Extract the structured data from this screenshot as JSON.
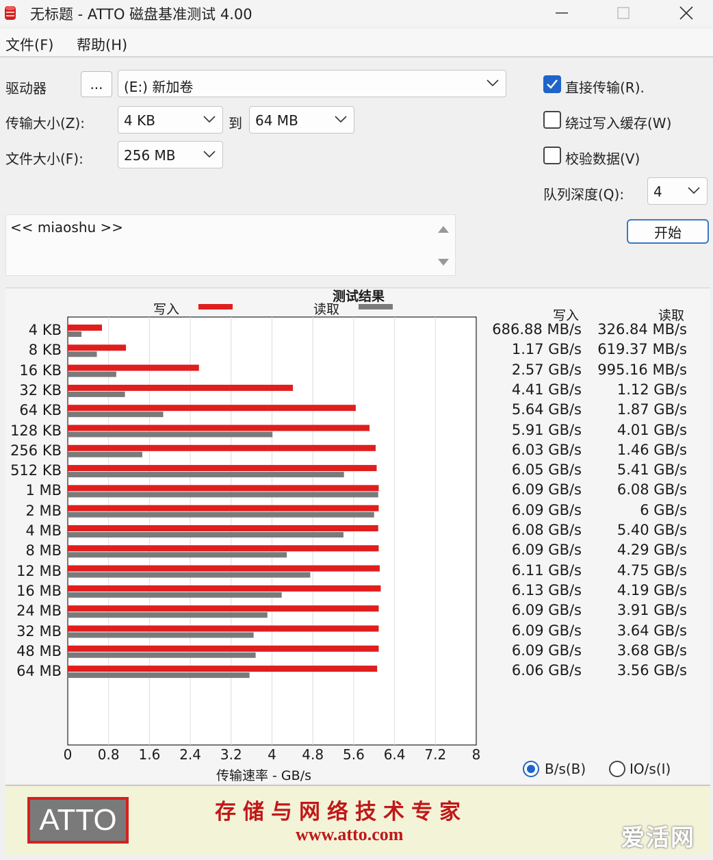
{
  "window": {
    "title": "无标题 - ATTO 磁盘基准测试 4.00",
    "icon": "atto-disk-icon",
    "controls": [
      "minimize-icon",
      "maximize-icon",
      "close-icon"
    ]
  },
  "menu": {
    "file": "文件(F)",
    "help": "帮助(H)"
  },
  "settings": {
    "drive_label": "驱动器",
    "browse_label": "...",
    "drive_value": "(E:) 新加卷",
    "transfer_size_label": "传输大小(Z):",
    "transfer_from": "4 KB",
    "to_label": "到",
    "transfer_to": "64 MB",
    "file_size_label": "文件大小(F):",
    "file_size": "256 MB",
    "direct_io_label": "直接传输(R).",
    "direct_io_checked": true,
    "bypass_cache_label": "绕过写入缓存(W)",
    "bypass_cache_checked": false,
    "verify_label": "校验数据(V)",
    "verify_checked": false,
    "queue_label": "队列深度(Q):",
    "queue_value": "4",
    "start_label": "开始"
  },
  "description": {
    "text": "<< miaoshu >>"
  },
  "results": {
    "title": "测试结果",
    "legend_write": "写入",
    "legend_read": "读取",
    "col_write": "写入",
    "col_read": "读取",
    "x_axis_title": "传输速率 - GB/s",
    "rows": [
      {
        "size": "4 KB",
        "write": "686.88 MB/s",
        "read": "326.84 MB/s"
      },
      {
        "size": "8 KB",
        "write": "1.17 GB/s",
        "read": "619.37 MB/s"
      },
      {
        "size": "16 KB",
        "write": "2.57 GB/s",
        "read": "995.16 MB/s"
      },
      {
        "size": "32 KB",
        "write": "4.41 GB/s",
        "read": "1.12 GB/s"
      },
      {
        "size": "64 KB",
        "write": "5.64 GB/s",
        "read": "1.87 GB/s"
      },
      {
        "size": "128 KB",
        "write": "5.91 GB/s",
        "read": "4.01 GB/s"
      },
      {
        "size": "256 KB",
        "write": "6.03 GB/s",
        "read": "1.46 GB/s"
      },
      {
        "size": "512 KB",
        "write": "6.05 GB/s",
        "read": "5.41 GB/s"
      },
      {
        "size": "1 MB",
        "write": "6.09 GB/s",
        "read": "6.08 GB/s"
      },
      {
        "size": "2 MB",
        "write": "6.09 GB/s",
        "read": "6 GB/s"
      },
      {
        "size": "4 MB",
        "write": "6.08 GB/s",
        "read": "5.40 GB/s"
      },
      {
        "size": "8 MB",
        "write": "6.09 GB/s",
        "read": "4.29 GB/s"
      },
      {
        "size": "12 MB",
        "write": "6.11 GB/s",
        "read": "4.75 GB/s"
      },
      {
        "size": "16 MB",
        "write": "6.13 GB/s",
        "read": "4.19 GB/s"
      },
      {
        "size": "24 MB",
        "write": "6.09 GB/s",
        "read": "3.91 GB/s"
      },
      {
        "size": "32 MB",
        "write": "6.09 GB/s",
        "read": "3.64 GB/s"
      },
      {
        "size": "48 MB",
        "write": "6.09 GB/s",
        "read": "3.68 GB/s"
      },
      {
        "size": "64 MB",
        "write": "6.06 GB/s",
        "read": "3.56 GB/s"
      }
    ],
    "unit_bytes_label": "B/s(B)",
    "unit_bytes_selected": true,
    "unit_io_label": "IO/s(I)",
    "unit_io_selected": false
  },
  "chart_data": {
    "type": "bar",
    "orientation": "horizontal",
    "title": "测试结果",
    "xlabel": "传输速率 - GB/s",
    "xlim": [
      0,
      8
    ],
    "xticks": [
      "0",
      "0.8",
      "1.6",
      "2.4",
      "3.2",
      "4",
      "4.8",
      "5.6",
      "6.4",
      "7.2",
      "8"
    ],
    "categories": [
      "4 KB",
      "8 KB",
      "16 KB",
      "32 KB",
      "64 KB",
      "128 KB",
      "256 KB",
      "512 KB",
      "1 MB",
      "2 MB",
      "4 MB",
      "8 MB",
      "12 MB",
      "16 MB",
      "24 MB",
      "32 MB",
      "48 MB",
      "64 MB"
    ],
    "series": [
      {
        "name": "写入",
        "color": "#e01e1e",
        "values": [
          0.67,
          1.14,
          2.57,
          4.41,
          5.64,
          5.91,
          6.03,
          6.05,
          6.09,
          6.09,
          6.08,
          6.09,
          6.11,
          6.13,
          6.09,
          6.09,
          6.09,
          6.06
        ]
      },
      {
        "name": "读取",
        "color": "#7a7a7a",
        "values": [
          0.27,
          0.57,
          0.95,
          1.12,
          1.87,
          4.01,
          1.46,
          5.41,
          6.08,
          6.0,
          5.4,
          4.29,
          4.75,
          4.19,
          3.91,
          3.64,
          3.68,
          3.56
        ]
      }
    ],
    "grid": true,
    "legend": "top"
  },
  "banner": {
    "logo": "ATTO",
    "slogan": "存储与网络技术专家",
    "url": "www.atto.com",
    "watermark": "爱活网"
  }
}
